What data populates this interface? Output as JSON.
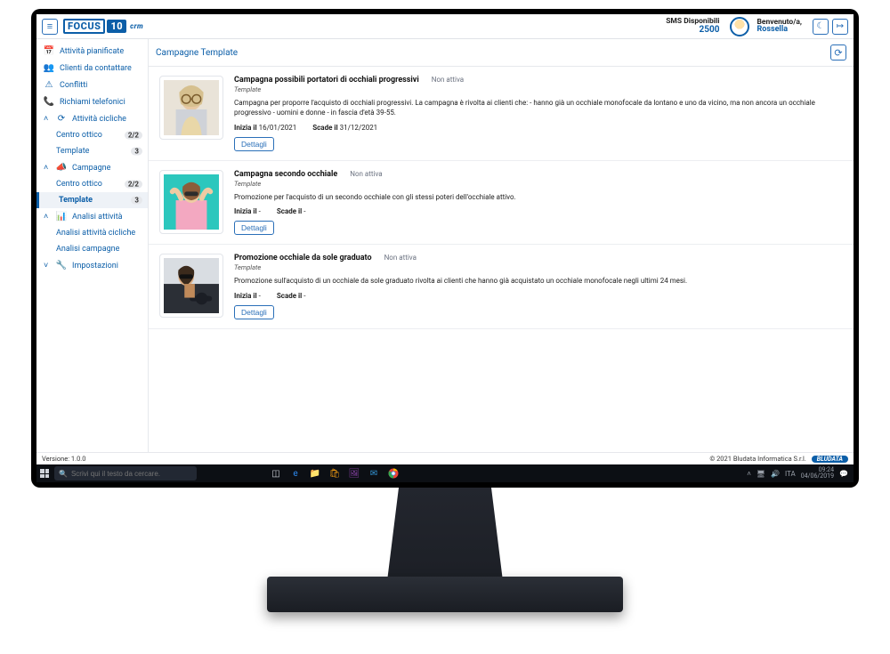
{
  "header": {
    "logo_focus": "FOCUS",
    "logo_io": "10",
    "logo_crm": "crm",
    "sms_label": "SMS Disponibili",
    "sms_count": "2500",
    "welcome_l1": "Benvenuto/a,",
    "welcome_l2": "Rossella"
  },
  "sidebar": {
    "items": [
      {
        "label": "Attività pianificate",
        "icon": "📅"
      },
      {
        "label": "Clienti da contattare",
        "icon": "👥"
      },
      {
        "label": "Conflitti",
        "icon": "⚠"
      },
      {
        "label": "Richiami telefonici",
        "icon": "📞"
      }
    ],
    "group_cicliche": {
      "label": "Attività cicliche",
      "caret": "˄",
      "items": [
        {
          "label": "Centro ottico",
          "badge": "2/2"
        },
        {
          "label": "Template",
          "badge": "3"
        }
      ]
    },
    "group_campagne": {
      "label": "Campagne",
      "caret": "˄",
      "items": [
        {
          "label": "Centro ottico",
          "badge": "2/2"
        },
        {
          "label": "Template",
          "badge": "3",
          "active": true
        }
      ]
    },
    "group_analisi": {
      "label": "Analisi attività",
      "caret": "˄",
      "items": [
        {
          "label": "Analisi attività cicliche"
        },
        {
          "label": "Analisi campagne"
        }
      ]
    },
    "group_impostazioni": {
      "label": "Impostazioni",
      "caret": "˅"
    }
  },
  "content": {
    "title": "Campagne Template",
    "cards": [
      {
        "title": "Campagna possibili portatori di occhiali progressivi",
        "status": "Non attiva",
        "sub": "Template",
        "desc": "Campagna per proporre l'acquisto di occhiali progressivi. La campagna è rivolta ai clienti che: - hanno già un occhiale monofocale da lontano e uno da vicino, ma non ancora un occhiale progressivo - uomini e donne - in fascia d'età 39-55.",
        "start_label": "Inizia il",
        "start": "16/01/2021",
        "end_label": "Scade il",
        "end": "31/12/2021",
        "button": "Dettagli"
      },
      {
        "title": "Campagna secondo occhiale",
        "status": "Non attiva",
        "sub": "Template",
        "desc": "Promozione per l'acquisto di un secondo occhiale con gli stessi poteri dell'occhiale attivo.",
        "start_label": "Inizia il",
        "start": "-",
        "end_label": "Scade il",
        "end": "-",
        "button": "Dettagli"
      },
      {
        "title": "Promozione occhiale da sole graduato",
        "status": "Non attiva",
        "sub": "Template",
        "desc": "Promozione sull'acquisto di un occhiale da sole graduato rivolta ai clienti che hanno già acquistato un occhiale monofocale negli ultimi 24 mesi.",
        "start_label": "Inizia il",
        "start": "-",
        "end_label": "Scade il",
        "end": "-",
        "button": "Dettagli"
      }
    ]
  },
  "footer": {
    "version": "Versione: 1.0.0",
    "copyright": "© 2021 Bludata Informatica S.r.l.",
    "brand": "BLUDATA"
  },
  "taskbar": {
    "search_placeholder": "Scrivi qui il testo da cercare.",
    "lang": "ITA",
    "time": "09:24",
    "date": "04/06/2019"
  }
}
